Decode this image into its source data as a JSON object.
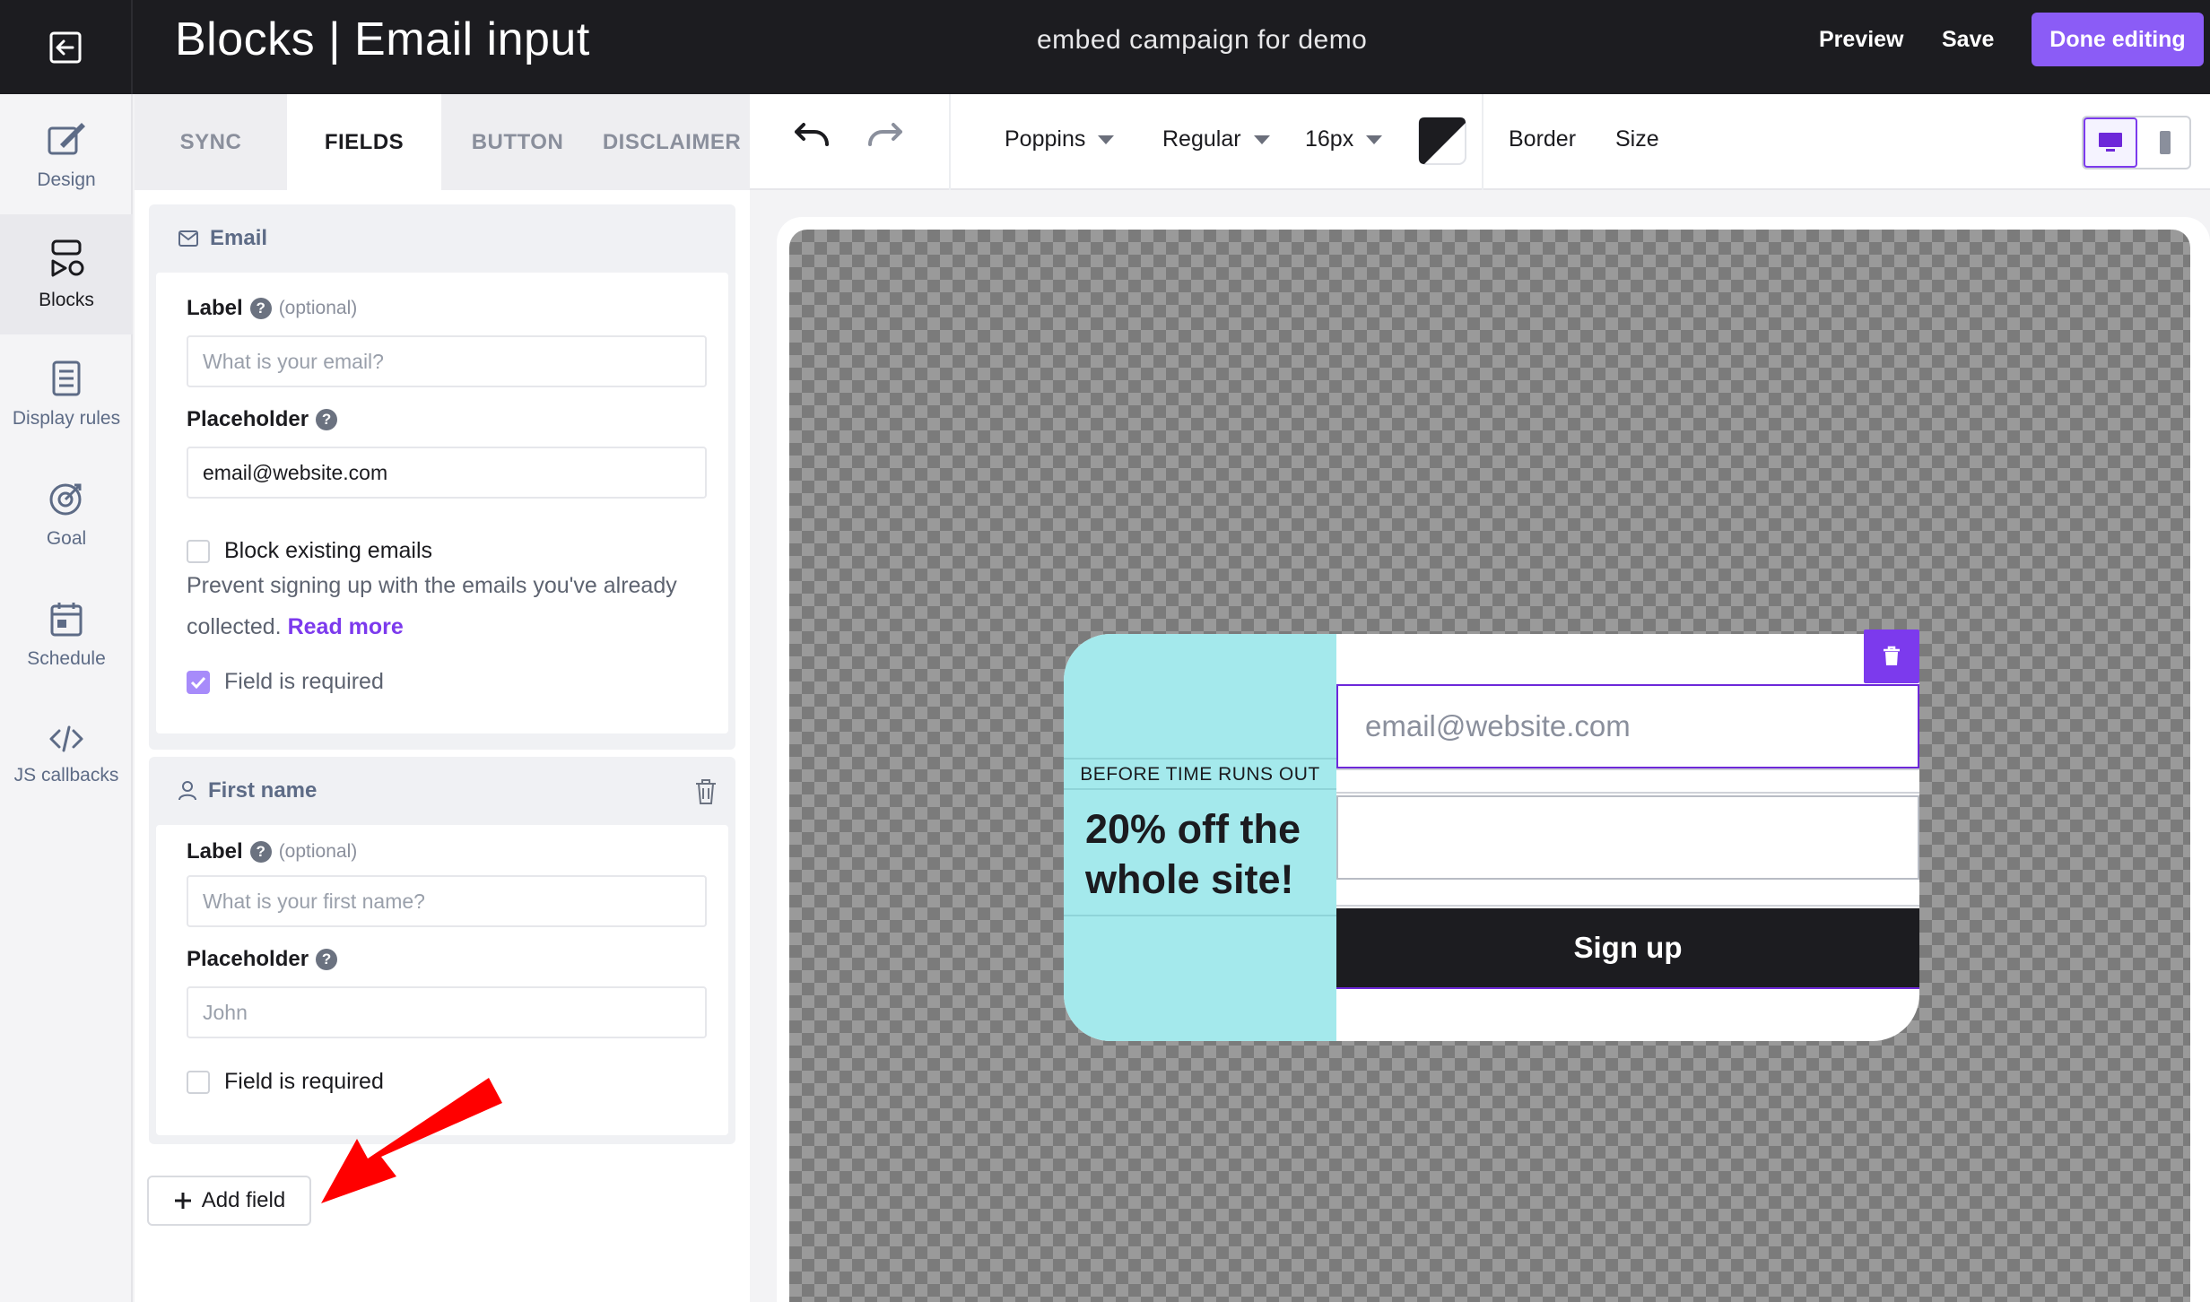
{
  "topbar": {
    "title": "Blocks | Email input",
    "campaign_name": "embed campaign for demo",
    "preview_label": "Preview",
    "save_label": "Save",
    "done_label": "Done editing"
  },
  "nav": {
    "items": [
      {
        "label": "Design",
        "icon": "design-icon"
      },
      {
        "label": "Blocks",
        "icon": "blocks-icon",
        "active": true
      },
      {
        "label": "Display rules",
        "icon": "document-icon"
      },
      {
        "label": "Goal",
        "icon": "target-icon"
      },
      {
        "label": "Schedule",
        "icon": "calendar-icon"
      },
      {
        "label": "JS callbacks",
        "icon": "code-icon"
      }
    ]
  },
  "tabs": {
    "sync": "SYNC",
    "fields": "FIELDS",
    "button": "BUTTON",
    "disclaimer": "DISCLAIMER",
    "active": "FIELDS"
  },
  "toolbar": {
    "font_family": "Poppins",
    "font_weight": "Regular",
    "font_size": "16px",
    "border_label": "Border",
    "size_label": "Size",
    "color": "#1c1c20"
  },
  "email_card": {
    "title": "Email",
    "label_label": "Label",
    "label_optional": "(optional)",
    "label_placeholder": "What is your email?",
    "placeholder_label": "Placeholder",
    "placeholder_value": "email@website.com",
    "block_existing_label": "Block existing emails",
    "block_existing_checked": false,
    "help_text": "Prevent signing up with the emails you've already collected.",
    "read_more": "Read more",
    "required_label": "Field is required",
    "required_checked": true
  },
  "firstname_card": {
    "title": "First name",
    "label_label": "Label",
    "label_optional": "(optional)",
    "label_placeholder": "What is your first name?",
    "placeholder_label": "Placeholder",
    "placeholder_value": "John",
    "required_label": "Field is required",
    "required_checked": false
  },
  "add_field_label": "Add field",
  "popup": {
    "pre_title": "BEFORE TIME RUNS OUT",
    "headline": "20% off the whole site!",
    "email_placeholder": "email@website.com",
    "signup_label": "Sign up",
    "accent_color": "#a4e9ec"
  },
  "colors": {
    "brand": "#8b5cf6",
    "selection": "#7c3aed",
    "annotation_arrow": "#ff0000"
  }
}
